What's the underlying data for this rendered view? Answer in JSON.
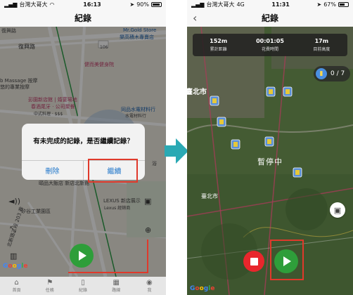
{
  "left": {
    "status": {
      "carrier": "台灣大哥大",
      "time": "16:13",
      "battery": "90%"
    },
    "title": "紀錄",
    "map_labels": [
      "復興路",
      "復興路",
      "Mr.Gold Store",
      "樂高積木專賣店",
      "106",
      "健而美健身院",
      "b Massage 按摩",
      "悠的專業按摩",
      "彭園新店館 | 婚宴場地",
      "春酒尾牙 · 公司聚餐",
      "中式料理 · $$$",
      "同品水電材料行",
      "水電材料行",
      "頤品大飯店 新店北新館",
      "LEXUS 新店展示",
      "Lexus 經銷商",
      "矽谷工業園區",
      "北新路三段 203 巷",
      "浴"
    ],
    "dialog": {
      "message": "有未完成的記錄，是否繼續記錄？",
      "cancel_label": "刪除",
      "confirm_label": "繼續"
    },
    "google_label": "Google",
    "tabs": [
      {
        "icon": "home-icon",
        "label": "首頁"
      },
      {
        "icon": "flag-icon",
        "label": "任務"
      },
      {
        "icon": "record-icon",
        "label": "紀錄"
      },
      {
        "icon": "explore-icon",
        "label": "路線"
      },
      {
        "icon": "profile-icon",
        "label": "我"
      }
    ]
  },
  "right": {
    "status": {
      "carrier": "台灣大哥大",
      "network": "4G",
      "time": "11:31",
      "battery": "67%"
    },
    "title": "紀錄",
    "stats": [
      {
        "value": "152m",
        "label": "累計距離"
      },
      {
        "value": "00:01:05",
        "label": "花費時間"
      },
      {
        "value": "17m",
        "label": "目前高度"
      }
    ],
    "checkpoints": "0 / 7",
    "map_labels": [
      "臺北市",
      "臺北市"
    ],
    "paused_text": "暫停中",
    "google_label": "Google"
  },
  "colors": {
    "play": "#2e9e3a",
    "stop": "#e8262c",
    "highlight": "#e0392b",
    "arrow": "#2aa9b4",
    "dialog_button": "#1c74c9"
  }
}
